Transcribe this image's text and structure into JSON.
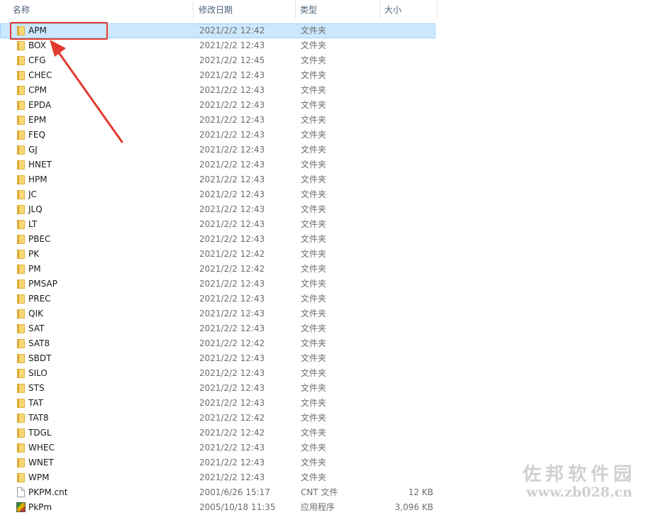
{
  "header": {
    "name_label": "名称",
    "date_label": "修改日期",
    "type_label": "类型",
    "size_label": "大小",
    "sort_icon": "chevron-up-icon"
  },
  "rows": [
    {
      "name": "APM",
      "date": "2021/2/2 12:42",
      "type": "文件夹",
      "size": "",
      "icon": "folder-icon",
      "selected": true
    },
    {
      "name": "BOX",
      "date": "2021/2/2 12:43",
      "type": "文件夹",
      "size": "",
      "icon": "folder-icon"
    },
    {
      "name": "CFG",
      "date": "2021/2/2 12:45",
      "type": "文件夹",
      "size": "",
      "icon": "folder-icon"
    },
    {
      "name": "CHEC",
      "date": "2021/2/2 12:43",
      "type": "文件夹",
      "size": "",
      "icon": "folder-icon"
    },
    {
      "name": "CPM",
      "date": "2021/2/2 12:43",
      "type": "文件夹",
      "size": "",
      "icon": "folder-icon"
    },
    {
      "name": "EPDA",
      "date": "2021/2/2 12:43",
      "type": "文件夹",
      "size": "",
      "icon": "folder-icon"
    },
    {
      "name": "EPM",
      "date": "2021/2/2 12:43",
      "type": "文件夹",
      "size": "",
      "icon": "folder-icon"
    },
    {
      "name": "FEQ",
      "date": "2021/2/2 12:43",
      "type": "文件夹",
      "size": "",
      "icon": "folder-icon"
    },
    {
      "name": "GJ",
      "date": "2021/2/2 12:43",
      "type": "文件夹",
      "size": "",
      "icon": "folder-icon"
    },
    {
      "name": "HNET",
      "date": "2021/2/2 12:43",
      "type": "文件夹",
      "size": "",
      "icon": "folder-icon"
    },
    {
      "name": "HPM",
      "date": "2021/2/2 12:43",
      "type": "文件夹",
      "size": "",
      "icon": "folder-icon"
    },
    {
      "name": "JC",
      "date": "2021/2/2 12:43",
      "type": "文件夹",
      "size": "",
      "icon": "folder-icon"
    },
    {
      "name": "JLQ",
      "date": "2021/2/2 12:43",
      "type": "文件夹",
      "size": "",
      "icon": "folder-icon"
    },
    {
      "name": "LT",
      "date": "2021/2/2 12:43",
      "type": "文件夹",
      "size": "",
      "icon": "folder-icon"
    },
    {
      "name": "PBEC",
      "date": "2021/2/2 12:43",
      "type": "文件夹",
      "size": "",
      "icon": "folder-icon"
    },
    {
      "name": "PK",
      "date": "2021/2/2 12:42",
      "type": "文件夹",
      "size": "",
      "icon": "folder-icon"
    },
    {
      "name": "PM",
      "date": "2021/2/2 12:42",
      "type": "文件夹",
      "size": "",
      "icon": "folder-icon"
    },
    {
      "name": "PMSAP",
      "date": "2021/2/2 12:43",
      "type": "文件夹",
      "size": "",
      "icon": "folder-icon"
    },
    {
      "name": "PREC",
      "date": "2021/2/2 12:43",
      "type": "文件夹",
      "size": "",
      "icon": "folder-icon"
    },
    {
      "name": "QIK",
      "date": "2021/2/2 12:43",
      "type": "文件夹",
      "size": "",
      "icon": "folder-icon"
    },
    {
      "name": "SAT",
      "date": "2021/2/2 12:43",
      "type": "文件夹",
      "size": "",
      "icon": "folder-icon"
    },
    {
      "name": "SAT8",
      "date": "2021/2/2 12:42",
      "type": "文件夹",
      "size": "",
      "icon": "folder-icon"
    },
    {
      "name": "SBDT",
      "date": "2021/2/2 12:43",
      "type": "文件夹",
      "size": "",
      "icon": "folder-icon"
    },
    {
      "name": "SILO",
      "date": "2021/2/2 12:43",
      "type": "文件夹",
      "size": "",
      "icon": "folder-icon"
    },
    {
      "name": "STS",
      "date": "2021/2/2 12:43",
      "type": "文件夹",
      "size": "",
      "icon": "folder-icon"
    },
    {
      "name": "TAT",
      "date": "2021/2/2 12:43",
      "type": "文件夹",
      "size": "",
      "icon": "folder-icon"
    },
    {
      "name": "TAT8",
      "date": "2021/2/2 12:42",
      "type": "文件夹",
      "size": "",
      "icon": "folder-icon"
    },
    {
      "name": "TDGL",
      "date": "2021/2/2 12:42",
      "type": "文件夹",
      "size": "",
      "icon": "folder-icon"
    },
    {
      "name": "WHEC",
      "date": "2021/2/2 12:43",
      "type": "文件夹",
      "size": "",
      "icon": "folder-icon"
    },
    {
      "name": "WNET",
      "date": "2021/2/2 12:43",
      "type": "文件夹",
      "size": "",
      "icon": "folder-icon"
    },
    {
      "name": "WPM",
      "date": "2021/2/2 12:43",
      "type": "文件夹",
      "size": "",
      "icon": "folder-icon"
    },
    {
      "name": "PKPM.cnt",
      "date": "2001/6/26 15:17",
      "type": "CNT 文件",
      "size": "12 KB",
      "icon": "document-icon"
    },
    {
      "name": "PkPm",
      "date": "2005/10/18 11:35",
      "type": "应用程序",
      "size": "3,096 KB",
      "icon": "application-icon"
    }
  ],
  "annotation": {
    "highlight_color": "#e23a2e",
    "arrow_icon": "red-arrow-icon"
  },
  "watermark": {
    "brand": "佐邦软件园",
    "url": "www.zb028.cn"
  },
  "colors": {
    "selection_bg": "#cce8ff",
    "selection_border": "#99d1ff",
    "folder": "#f8d775"
  }
}
